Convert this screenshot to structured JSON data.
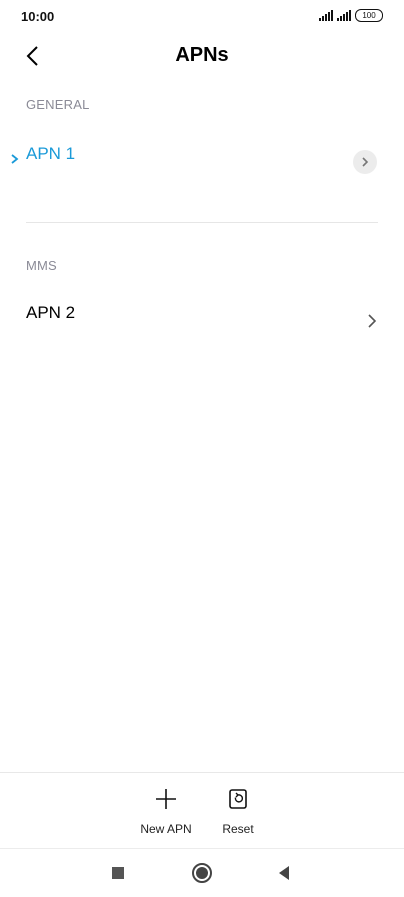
{
  "status_bar": {
    "time": "10:00",
    "battery": "100"
  },
  "header": {
    "title": "APNs",
    "back_icon": "chevron-left-icon"
  },
  "sections": [
    {
      "label": "GENERAL",
      "items": [
        {
          "name": "APN 1",
          "selected": true
        }
      ]
    },
    {
      "label": "MMS",
      "items": [
        {
          "name": "APN 2",
          "selected": false
        }
      ]
    }
  ],
  "actions": {
    "new_apn_label": "New APN",
    "reset_label": "Reset"
  },
  "colors": {
    "accent": "#1a9ad8",
    "section_label": "#8a8a96"
  },
  "navigation": {
    "recents_icon": "square-icon",
    "home_icon": "circle-icon",
    "back_icon": "triangle-back-icon"
  }
}
